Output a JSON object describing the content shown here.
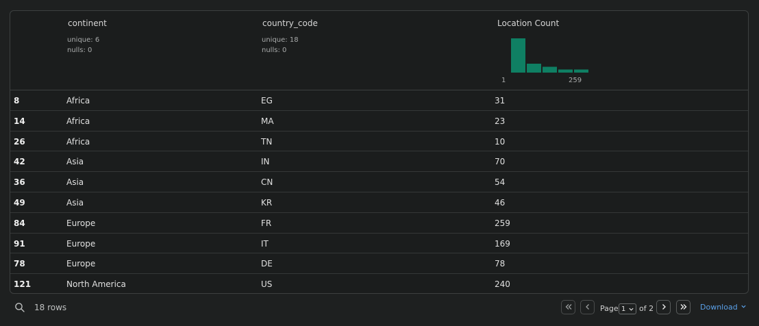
{
  "columns": {
    "continent": {
      "name": "continent",
      "unique": "unique: 6",
      "nulls": "nulls: 0"
    },
    "country_code": {
      "name": "country_code",
      "unique": "unique: 18",
      "nulls": "nulls: 0"
    },
    "location_count": {
      "name": "Location Count",
      "hist_min": "1",
      "hist_max": "259",
      "hist_bins": [
        10,
        2.6,
        1.7,
        0.9,
        0.9
      ],
      "hist_color": "#0f7f63"
    }
  },
  "rows": [
    {
      "idx": "8",
      "continent": "Africa",
      "country_code": "EG",
      "count": "31"
    },
    {
      "idx": "14",
      "continent": "Africa",
      "country_code": "MA",
      "count": "23"
    },
    {
      "idx": "26",
      "continent": "Africa",
      "country_code": "TN",
      "count": "10"
    },
    {
      "idx": "42",
      "continent": "Asia",
      "country_code": "IN",
      "count": "70"
    },
    {
      "idx": "36",
      "continent": "Asia",
      "country_code": "CN",
      "count": "54"
    },
    {
      "idx": "49",
      "continent": "Asia",
      "country_code": "KR",
      "count": "46"
    },
    {
      "idx": "84",
      "continent": "Europe",
      "country_code": "FR",
      "count": "259"
    },
    {
      "idx": "91",
      "continent": "Europe",
      "country_code": "IT",
      "count": "169"
    },
    {
      "idx": "78",
      "continent": "Europe",
      "country_code": "DE",
      "count": "78"
    },
    {
      "idx": "121",
      "continent": "North America",
      "country_code": "US",
      "count": "240"
    }
  ],
  "footer": {
    "rows_count": "18 rows",
    "page_label": "Page",
    "page_value": "1",
    "page_of": "of 2",
    "download_label": "Download"
  },
  "icons": {
    "search": "search-icon",
    "first": "chevrons-left-icon",
    "prev": "chevron-left-icon",
    "next": "chevron-right-icon",
    "last": "chevrons-right-icon",
    "dropdown": "chevron-down-icon"
  },
  "colors": {
    "accent": "#5aa0e8",
    "histogram": "#0f7f63"
  }
}
